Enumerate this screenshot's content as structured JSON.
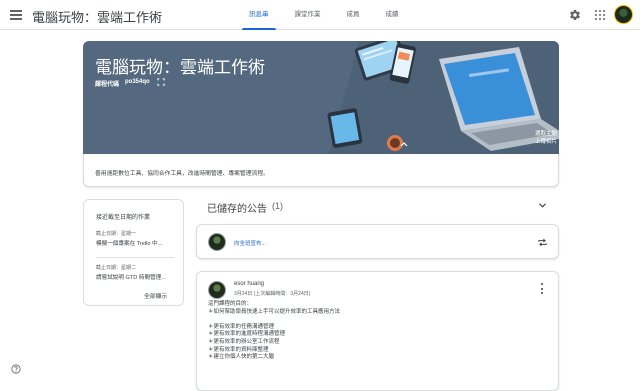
{
  "app": {
    "title": "電腦玩物：雲端工作術",
    "tabs": [
      {
        "label": "訊息串",
        "active": true
      },
      {
        "label": "課堂作業",
        "active": false
      },
      {
        "label": "成員",
        "active": false
      },
      {
        "label": "成績",
        "active": false
      }
    ],
    "accent_color": "#1967d2"
  },
  "banner": {
    "title": "電腦玩物：雲端工作術",
    "code_label": "課程代碼",
    "code_value": "po354qo",
    "select_theme": "選取主題",
    "upload_photo": "上傳相片",
    "background_color": "#54697f"
  },
  "description": "善用遠距數位工具、協同合作工具，改進時間管理、專案管理流程。",
  "upcoming": {
    "title": "接近截至日期的作業",
    "items": [
      {
        "due": "截止日期：星期一",
        "name": "模擬一個專案在 Trello 中..."
      },
      {
        "due": "截止日期：星期二",
        "name": "請嘗試說明 GTD 時間管理..."
      }
    ],
    "view_all": "全部顯示"
  },
  "saved": {
    "title": "已儲存的公告",
    "count": "(1)"
  },
  "share": {
    "placeholder": "向全班宣布..."
  },
  "post": {
    "author": "esor huang",
    "time": "3月24日 (上次編輯時間：3月24日)",
    "lines": [
      "這門課程的目的：",
      "＊如何幫助學員快速上手可以提升效率的工具應用方法",
      "",
      "＊更有效率的任務溝通管理",
      "＊更有效率的進度時程溝通管理",
      "＊更有效率的辦公室工作流程",
      "＊更有效率的資料庫整理",
      "＊建立你個人快的第二大腦"
    ]
  },
  "icons": [
    "menu-icon",
    "gear-icon",
    "apps-icon",
    "fullscreen-icon",
    "expand-icon",
    "chevron-down-icon",
    "repost-icon",
    "more-icon",
    "help-icon"
  ]
}
